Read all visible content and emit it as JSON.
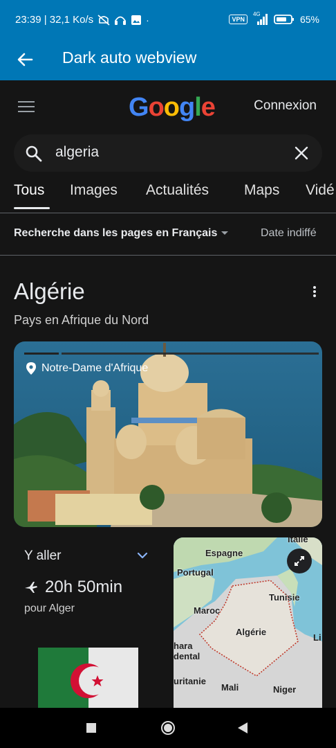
{
  "status_bar": {
    "time_speed": "23:39 | 32,1 Ko/s",
    "vpn": "VPN",
    "network": "4G",
    "battery": "65%"
  },
  "app_bar": {
    "title": "Dark auto webview"
  },
  "google": {
    "logo": "Google",
    "sign_in": "Connexion",
    "search_value": "algeria"
  },
  "tabs": [
    "Tous",
    "Images",
    "Actualités",
    "Maps",
    "Vidé"
  ],
  "filters": {
    "language": "Recherche dans les pages en Français",
    "date": "Date indiffé"
  },
  "knowledge_panel": {
    "title": "Algérie",
    "subtitle": "Pays en Afrique du Nord",
    "photo_label": "Notre-Dame d'Afrique",
    "travel": {
      "title": "Y aller",
      "duration": "20h 50min",
      "destination": "pour Alger"
    },
    "map_labels": {
      "italie": "Italie",
      "espagne": "Espagne",
      "portugal": "Portugal",
      "tunisie": "Tunisie",
      "maroc": "Maroc",
      "algerie": "Algérie",
      "li": "Li",
      "sahara1": "hara",
      "sahara2": "dental",
      "mauritanie": "uritanie",
      "mali": "Mali",
      "niger": "Niger"
    }
  },
  "colors": {
    "app_bar": "#0077b6",
    "page_bg": "#151515",
    "google_blue": "#4285f4",
    "google_red": "#ea4335",
    "google_yellow": "#fbbc05",
    "google_green": "#34a853"
  }
}
